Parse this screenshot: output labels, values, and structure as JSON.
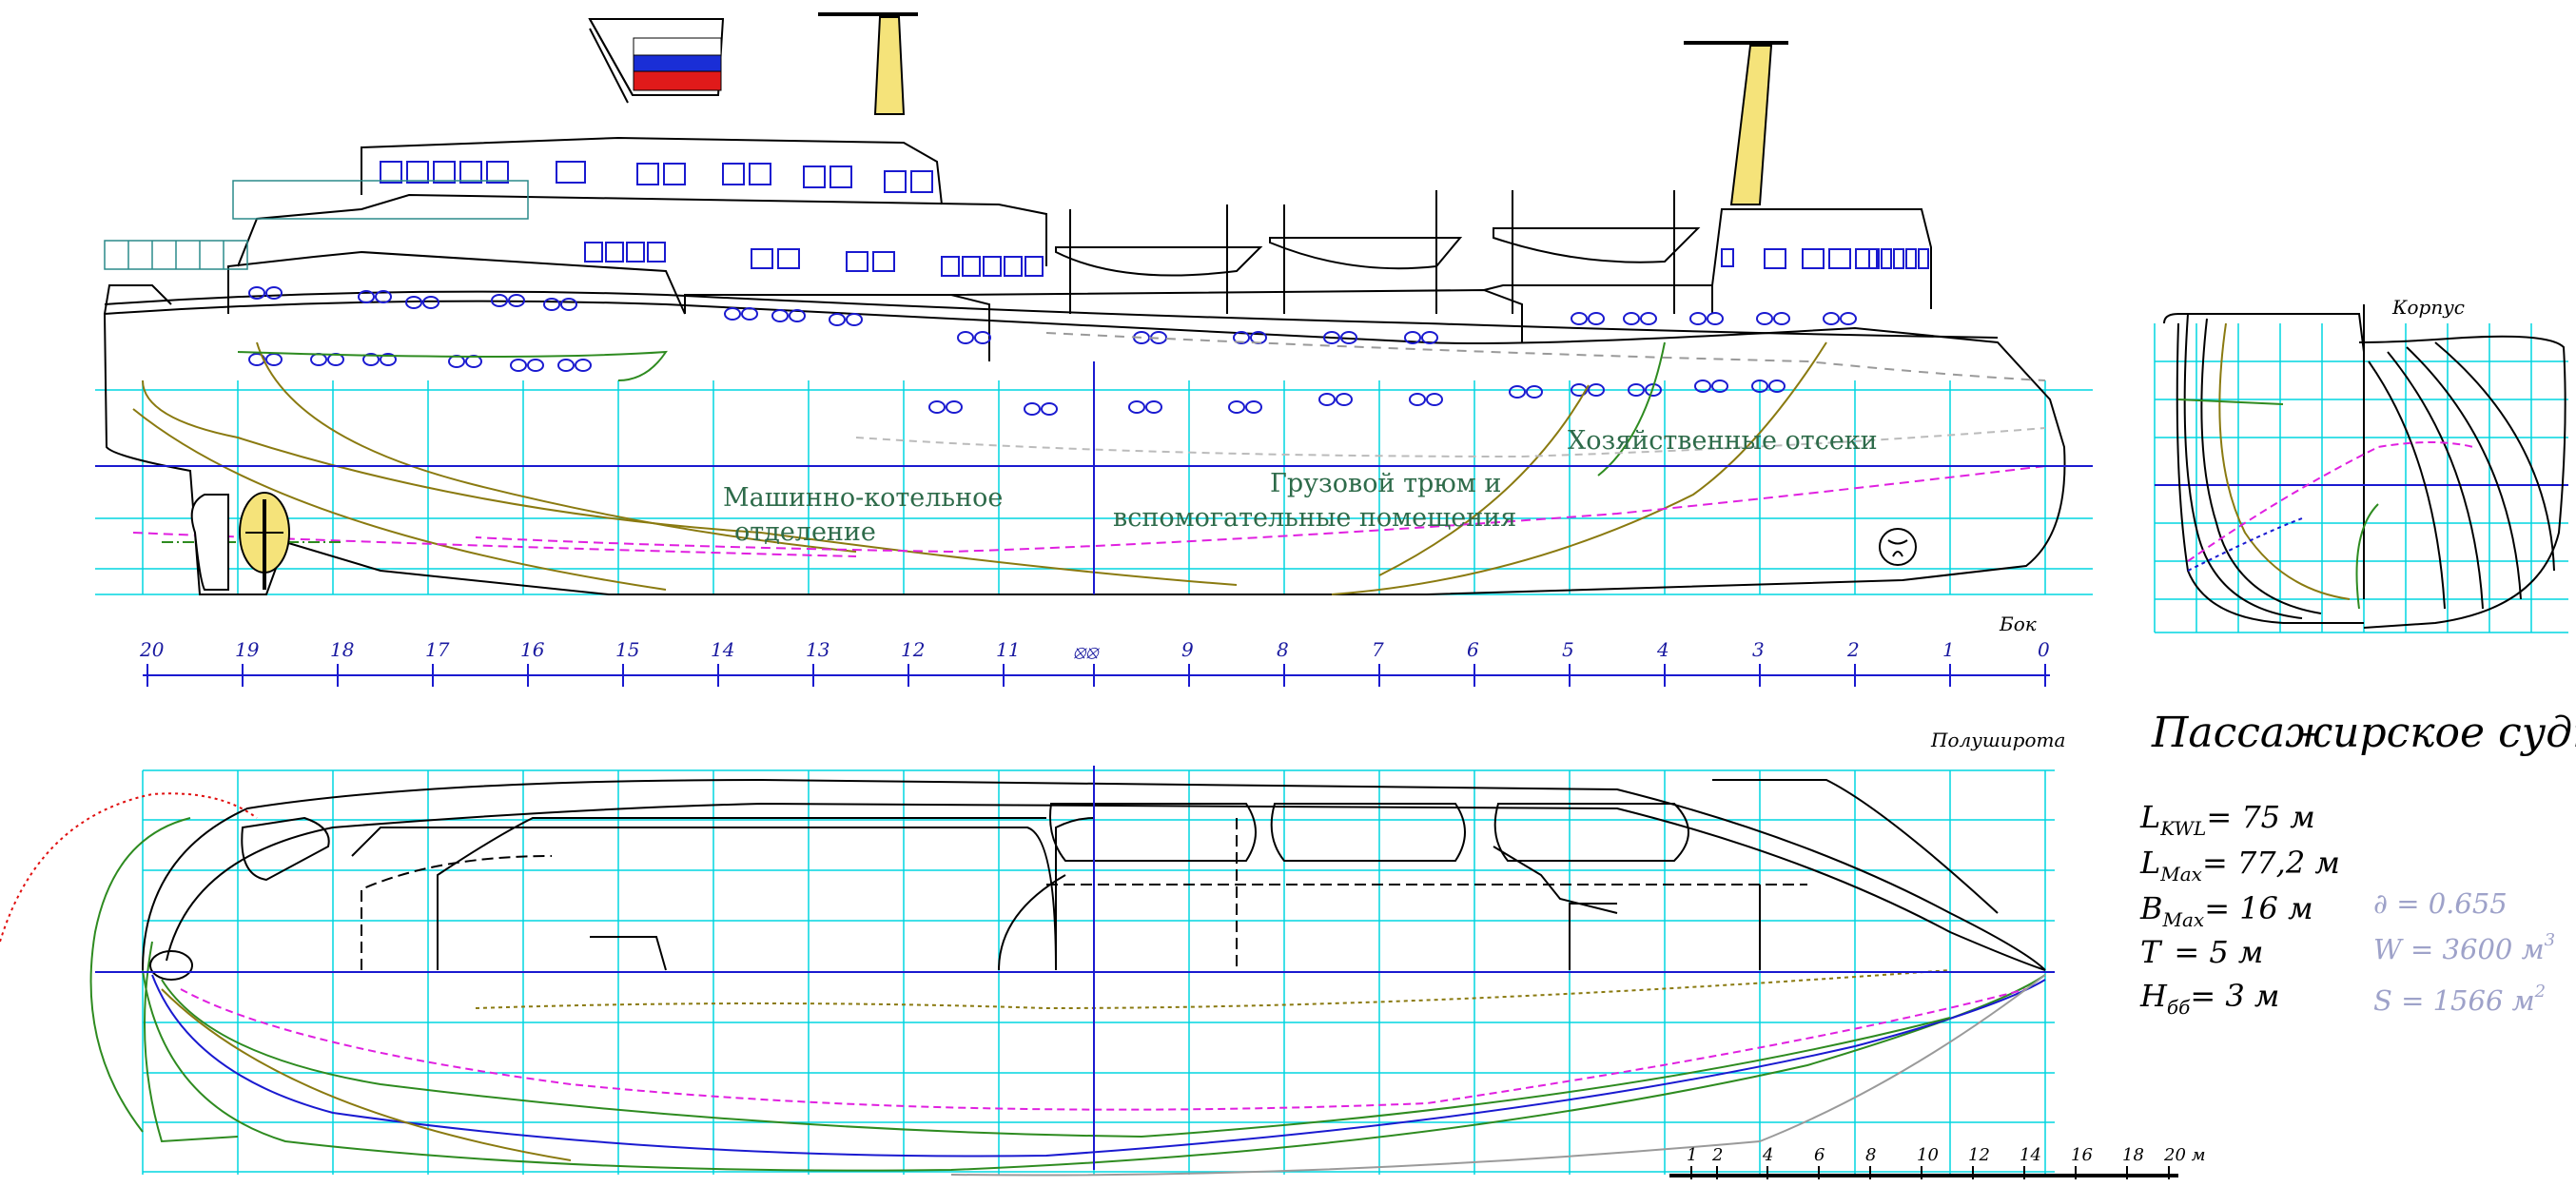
{
  "labels": {
    "engine_room_1": "Машинно-котельное",
    "engine_room_2": "отделение",
    "cargo_1": "Грузовой трюм и",
    "cargo_2": "вспомогательные помещения",
    "service": "Хозяйственные отсеки",
    "side_view": "Бок",
    "half_breadth": "Полуширота",
    "body_plan": "Корпус"
  },
  "station_ticks": [
    "20",
    "19",
    "18",
    "17",
    "16",
    "15",
    "14",
    "13",
    "12",
    "11",
    "9",
    "8",
    "7",
    "6",
    "5",
    "4",
    "3",
    "2",
    "1",
    "0"
  ],
  "midship_symbol": "⦻⦻",
  "title": "Пассажирское судно",
  "dimensions": {
    "l_kwl": "L",
    "l_kwl_sub": "KWL",
    "l_kwl_val": "= 75 м",
    "l_max": "L",
    "l_max_sub": "Max",
    "l_max_val": "= 77,2 м",
    "b_max": "B",
    "b_max_sub": "Max",
    "b_max_val": "= 16 м",
    "t": "T",
    "t_val": "=   5 м",
    "h": "H",
    "h_sub": "бб",
    "h_val": "=   3 м"
  },
  "coefficients": {
    "delta": "∂ = 0.655",
    "w": "W = 3600 м",
    "w_sup": "3",
    "s": "S = 1566 м",
    "s_sup": "2"
  },
  "scale_labels": [
    "1",
    "2",
    "4",
    "6",
    "8",
    "10",
    "12",
    "14",
    "16",
    "18",
    "20 м"
  ],
  "colors": {
    "grid": "#00d5e0",
    "waterline": "#1a1ad0",
    "flag_white": "#ffffff",
    "flag_blue": "#1a2ed6",
    "flag_red": "#e01a1a",
    "mast_yellow": "#f5e37a",
    "olive": "#8a7a10",
    "magenta": "#e020e0",
    "green": "#2e8b20",
    "red_dotted": "#e01010"
  }
}
